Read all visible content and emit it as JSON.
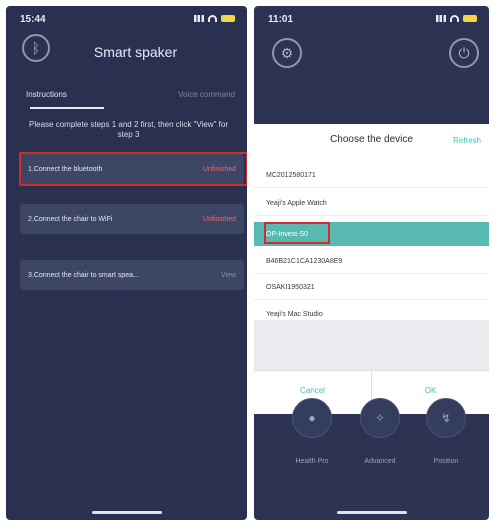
{
  "left": {
    "status_time": "15:44",
    "title": "Smart spaker",
    "tabs": [
      "Instructions",
      "Voice command"
    ],
    "note": "Please complete steps 1 and 2 first, then click \"View\" for step 3",
    "steps": [
      {
        "label": "1.Connect the bluetooth",
        "state": "Unfinished"
      },
      {
        "label": "2.Connect the chair to WiFi",
        "state": "Unfinished"
      },
      {
        "label": "3.Connect the chair to smart spea...",
        "state": "View"
      }
    ]
  },
  "right": {
    "status_time": "11:01",
    "sheet": {
      "title": "Choose the device",
      "refresh": "Refresh",
      "devices": [
        "MC2012580171",
        "Yeaji's Apple Watch",
        "OP-Invest-S0",
        "B46B21C1CA1230A8E9",
        "OSAKI1950321",
        "Yeaji's Mac Studio"
      ],
      "selected_index": 2,
      "cancel": "Cancel",
      "ok": "OK"
    },
    "bottom_nav": [
      "Health Pro",
      "Advanced",
      "Position"
    ]
  }
}
